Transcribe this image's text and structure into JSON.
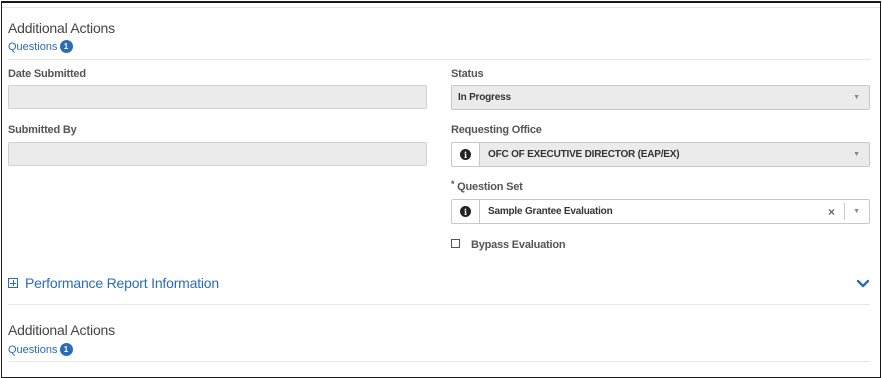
{
  "section1": {
    "title": "Additional Actions",
    "link": "Questions",
    "count": "1"
  },
  "left": {
    "date_submitted_label": "Date Submitted",
    "submitted_by_label": "Submitted By"
  },
  "right": {
    "status_label": "Status",
    "status_value": "In Progress",
    "office_label": "Requesting Office",
    "office_value": "OFC OF EXECUTIVE DIRECTOR (EAP/EX)",
    "required_marker": "*",
    "question_set_label": "Question Set",
    "question_set_value": "Sample Grantee Evaluation",
    "clear_glyph": "×",
    "bypass_label": "Bypass Evaluation"
  },
  "performance": {
    "title": "Performance Report Information"
  },
  "section2": {
    "title": "Additional Actions",
    "link": "Questions",
    "count": "1"
  },
  "icons": {
    "info": "info-icon",
    "caret": "caret-down-icon",
    "expand": "plus-square-icon",
    "chevron": "chevron-down-icon"
  },
  "colors": {
    "accent": "#2a6cb8",
    "field_bg": "#ebebeb"
  }
}
